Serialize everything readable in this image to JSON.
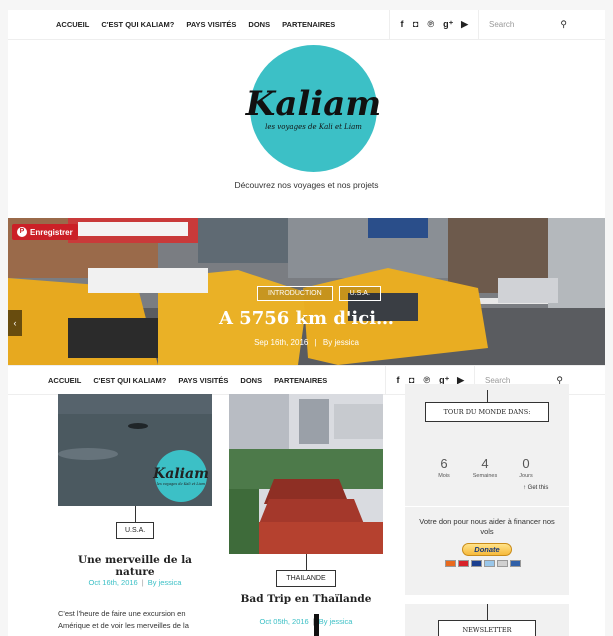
{
  "nav_top": {
    "items": [
      "ACCUEIL",
      "C'EST QUI KALIAM?",
      "PAYS VISITÉS",
      "DONS",
      "PARTENAIRES"
    ],
    "social_icons": [
      "facebook-icon",
      "instagram-icon",
      "pinterest-icon",
      "google-plus-icon",
      "youtube-icon"
    ],
    "search_placeholder": "Search"
  },
  "logo": {
    "title": "Kaliam",
    "subtitle": "les voyages de Kali et Liam",
    "color": "#3cc0c6"
  },
  "tagline": "Découvrez nos voyages et nos projets",
  "hero": {
    "pin_label": "Enregistrer",
    "tags": [
      "INTRODUCTION",
      "U.S.A."
    ],
    "title": "A 5756 km d'ici…",
    "date": "Sep 16th, 2016",
    "author": "By jessica"
  },
  "nav_sticky": {
    "items": [
      "ACCUEIL",
      "C'EST QUI KALIAM?",
      "PAYS VISITÉS",
      "DONS",
      "PARTENAIRES"
    ],
    "search_placeholder": "Search"
  },
  "posts": [
    {
      "tag": "U.S.A.",
      "title": "Une merveille de la nature",
      "date": "Oct 16th, 2016",
      "author": "By jessica",
      "excerpt": "C'est l'heure de faire une excursion en Amérique et de voir les merveilles de la",
      "watermark_title": "Kaliam",
      "watermark_sub": "les voyages de Kali et Liam"
    },
    {
      "tag": "THAILANDE",
      "title": "Bad Trip en Thaïlande",
      "date": "Oct 05th, 2016",
      "author": "By jessica"
    }
  ],
  "widgets": {
    "tour_title": "TOUR DU MONDE DANS:",
    "countdown": [
      {
        "value": "6",
        "label": "Mois"
      },
      {
        "value": "4",
        "label": "Semaines"
      },
      {
        "value": "0",
        "label": "Jours"
      }
    ],
    "get_this": "↑ Get this",
    "donation_text": "Votre don pour nous aider à financer nos vols",
    "donate_label": "Donate",
    "newsletter_title": "NEWSLETTER"
  }
}
